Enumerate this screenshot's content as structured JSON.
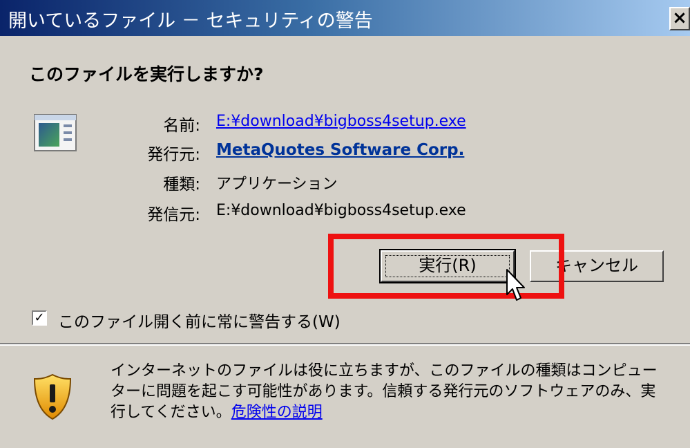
{
  "window": {
    "title": "開いているファイル － セキュリティの警告",
    "close_label": "×"
  },
  "dialog": {
    "question": "このファイルを実行しますか?",
    "fields": {
      "name_label": "名前:",
      "name_value": "E:¥download¥bigboss4setup.exe",
      "publisher_label": "発行元:",
      "publisher_value": "MetaQuotes Software Corp.",
      "type_label": "種類:",
      "type_value": "アプリケーション",
      "from_label": "発信元:",
      "from_value": "E:¥download¥bigboss4setup.exe"
    },
    "buttons": {
      "run_label": "実行(R)",
      "cancel_label": "キャンセル"
    },
    "checkbox": {
      "checked": true,
      "mark": "✓",
      "label": "このファイル開く前に常に警告する(W)"
    },
    "warning": {
      "text": "インターネットのファイルは役に立ちますが、このファイルの種類はコンピューターに問題を起こす可能性があります。信頼する発行元のソフトウェアのみ、実行してください。",
      "link": "危険性の説明"
    }
  },
  "colors": {
    "titlebar_start": "#0a246a",
    "titlebar_end": "#a6caf0",
    "dialog_bg": "#d4d0c8",
    "highlight": "#ee1111",
    "link": "#0000ee"
  },
  "icons": {
    "app": "application-window-icon",
    "shield": "shield-warning-icon",
    "cursor": "mouse-pointer-icon"
  }
}
